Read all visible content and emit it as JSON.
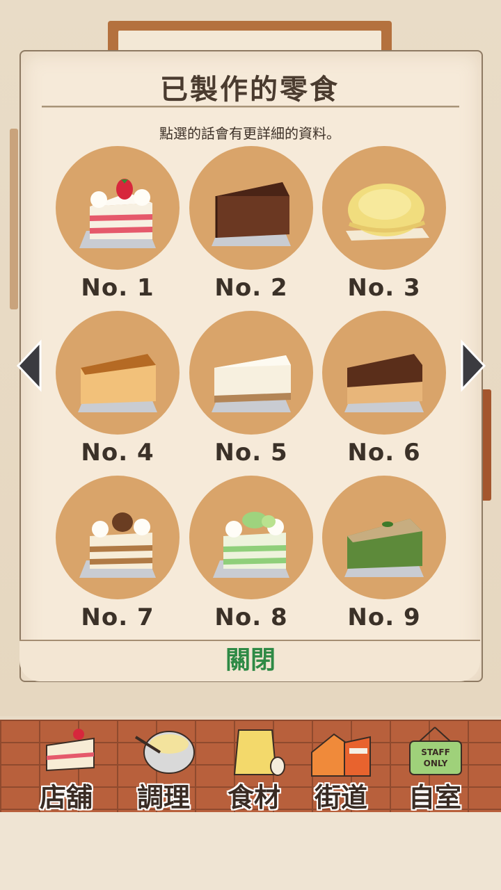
{
  "dialog": {
    "title": "已製作的零食",
    "subtitle": "點選的話會有更詳細的資料。",
    "close_label": "關閉"
  },
  "snacks": [
    {
      "label": "No. 1",
      "name": "strawberry-shortcake-icon"
    },
    {
      "label": "No. 2",
      "name": "chocolate-cake-icon"
    },
    {
      "label": "No. 3",
      "name": "cream-puff-icon"
    },
    {
      "label": "No. 4",
      "name": "baked-cheesecake-icon"
    },
    {
      "label": "No. 5",
      "name": "rare-cheesecake-icon"
    },
    {
      "label": "No. 6",
      "name": "chocolate-cheesecake-icon"
    },
    {
      "label": "No. 7",
      "name": "chestnut-shortcake-icon"
    },
    {
      "label": "No. 8",
      "name": "melon-shortcake-icon"
    },
    {
      "label": "No. 9",
      "name": "matcha-cake-icon"
    }
  ],
  "nav": {
    "items": [
      {
        "label": "店舖",
        "icon": "cake-slice-icon"
      },
      {
        "label": "調理",
        "icon": "mixing-bowl-icon"
      },
      {
        "label": "食材",
        "icon": "flour-bag-icon"
      },
      {
        "label": "街道",
        "icon": "street-houses-icon"
      },
      {
        "label": "自室",
        "icon": "staff-only-sign-icon",
        "sign_text": "STAFF ONLY"
      }
    ]
  },
  "colors": {
    "plate": "#d9a46a",
    "close_text": "#2e8a45",
    "brick": "#b8603c"
  }
}
